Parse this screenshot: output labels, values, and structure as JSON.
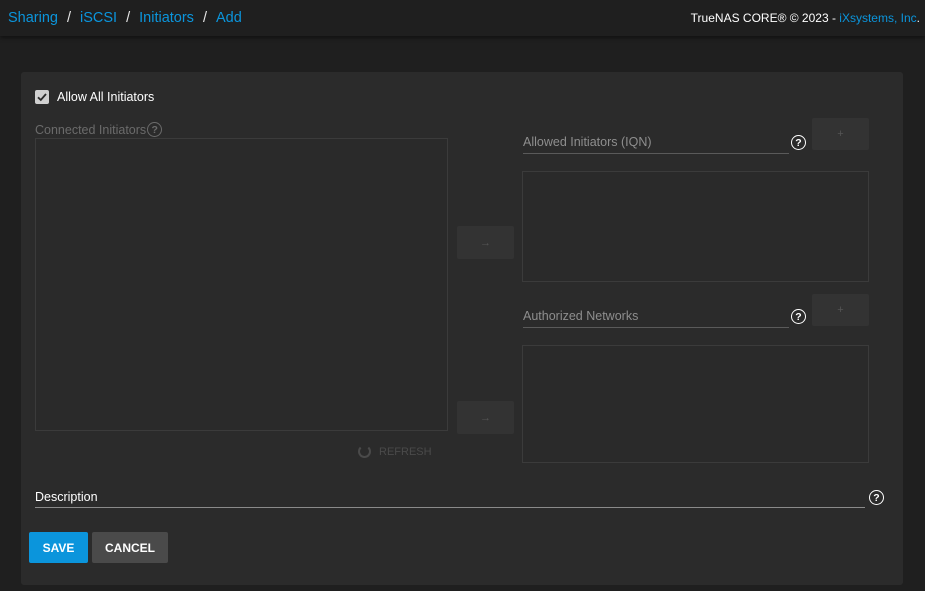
{
  "breadcrumb": [
    "Sharing",
    "iSCSI",
    "Initiators",
    "Add"
  ],
  "copyright": {
    "prefix": "TrueNAS CORE® © 2023 - ",
    "brand": "iXsystems, Inc",
    "suffix": "."
  },
  "form": {
    "allow_all": {
      "label": "Allow All Initiators",
      "checked": true
    },
    "connected": {
      "label": "Connected Initiators",
      "refresh_label": "REFRESH"
    },
    "allowed": {
      "label": "Allowed Initiators (IQN)",
      "value": ""
    },
    "networks": {
      "label": "Authorized Networks",
      "value": ""
    },
    "description": {
      "label": "Description",
      "value": ""
    },
    "help_glyph": "?"
  },
  "actions": {
    "save": "SAVE",
    "cancel": "CANCEL"
  },
  "colors": {
    "accent": "#0b95dc",
    "card": "#2b2b2b",
    "background": "#1f1f1f"
  }
}
